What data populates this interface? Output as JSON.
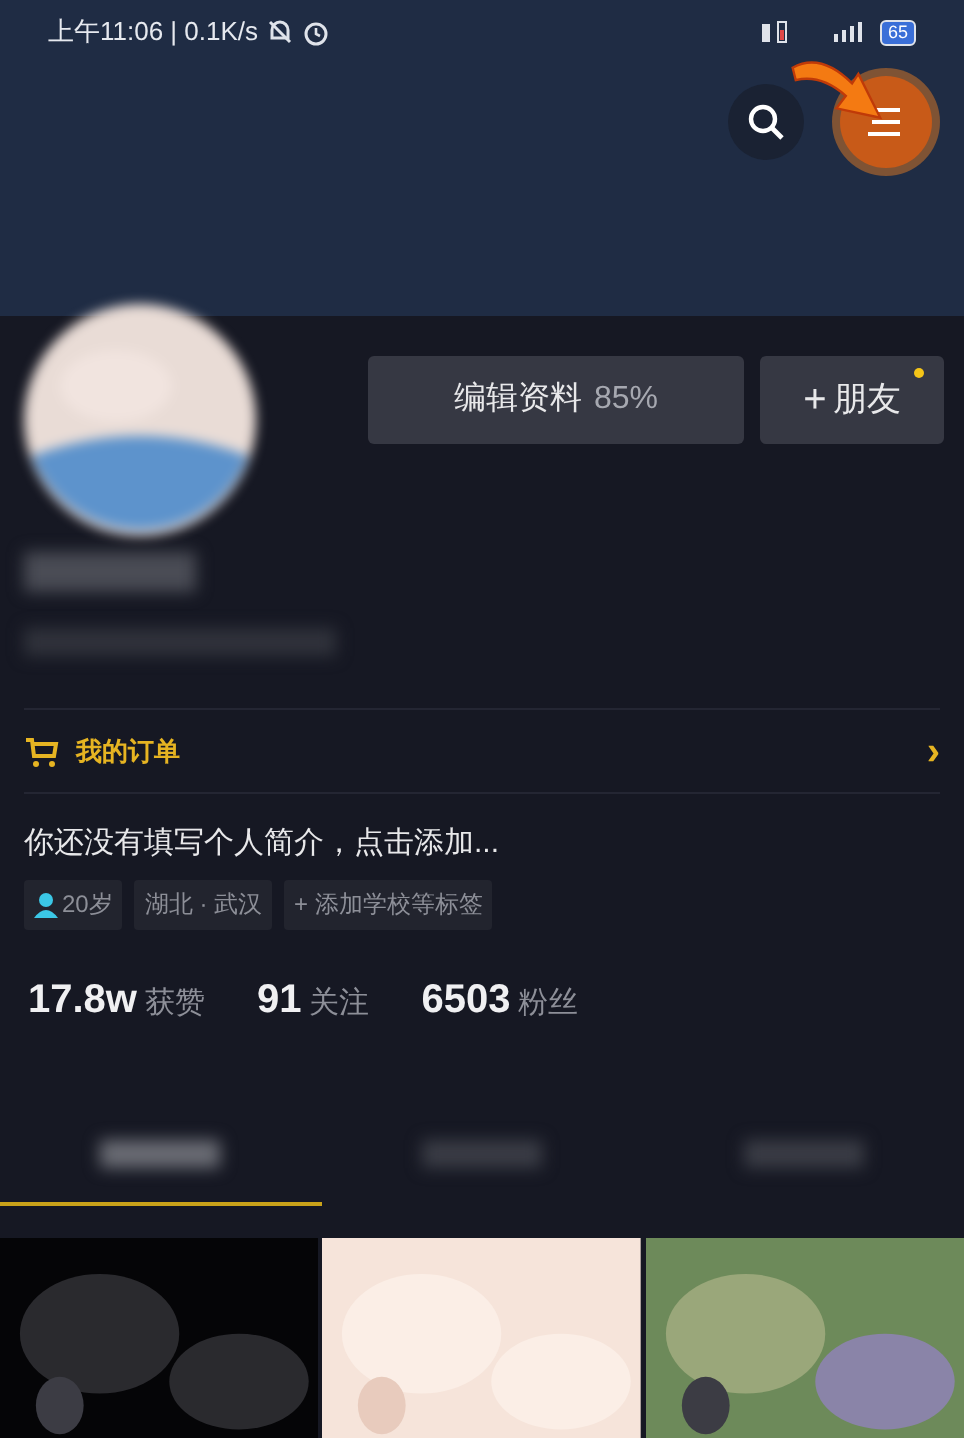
{
  "status_bar": {
    "time": "上午11:06 | 0.1K/s",
    "battery": "65"
  },
  "profile": {
    "edit_button": {
      "label": "编辑资料",
      "progress": "85%"
    },
    "friend_button": {
      "plus": "+",
      "label": "朋友",
      "new_dot": true
    }
  },
  "order_row": {
    "label": "我的订单",
    "chevron": "›"
  },
  "bio": "你还没有填写个人简介，点击添加...",
  "tags": [
    {
      "kind": "age",
      "label": "20岁"
    },
    {
      "kind": "plain",
      "label": "湖北 · 武汉"
    },
    {
      "kind": "plain",
      "label": "+ 添加学校等标签"
    }
  ],
  "stats": [
    {
      "count": "17.8w",
      "caption": "获赞"
    },
    {
      "count": "91",
      "caption": "关注"
    },
    {
      "count": "6503",
      "caption": "粉丝"
    }
  ],
  "tabs": [
    {
      "selected": true
    },
    {
      "selected": false
    },
    {
      "selected": false
    }
  ]
}
